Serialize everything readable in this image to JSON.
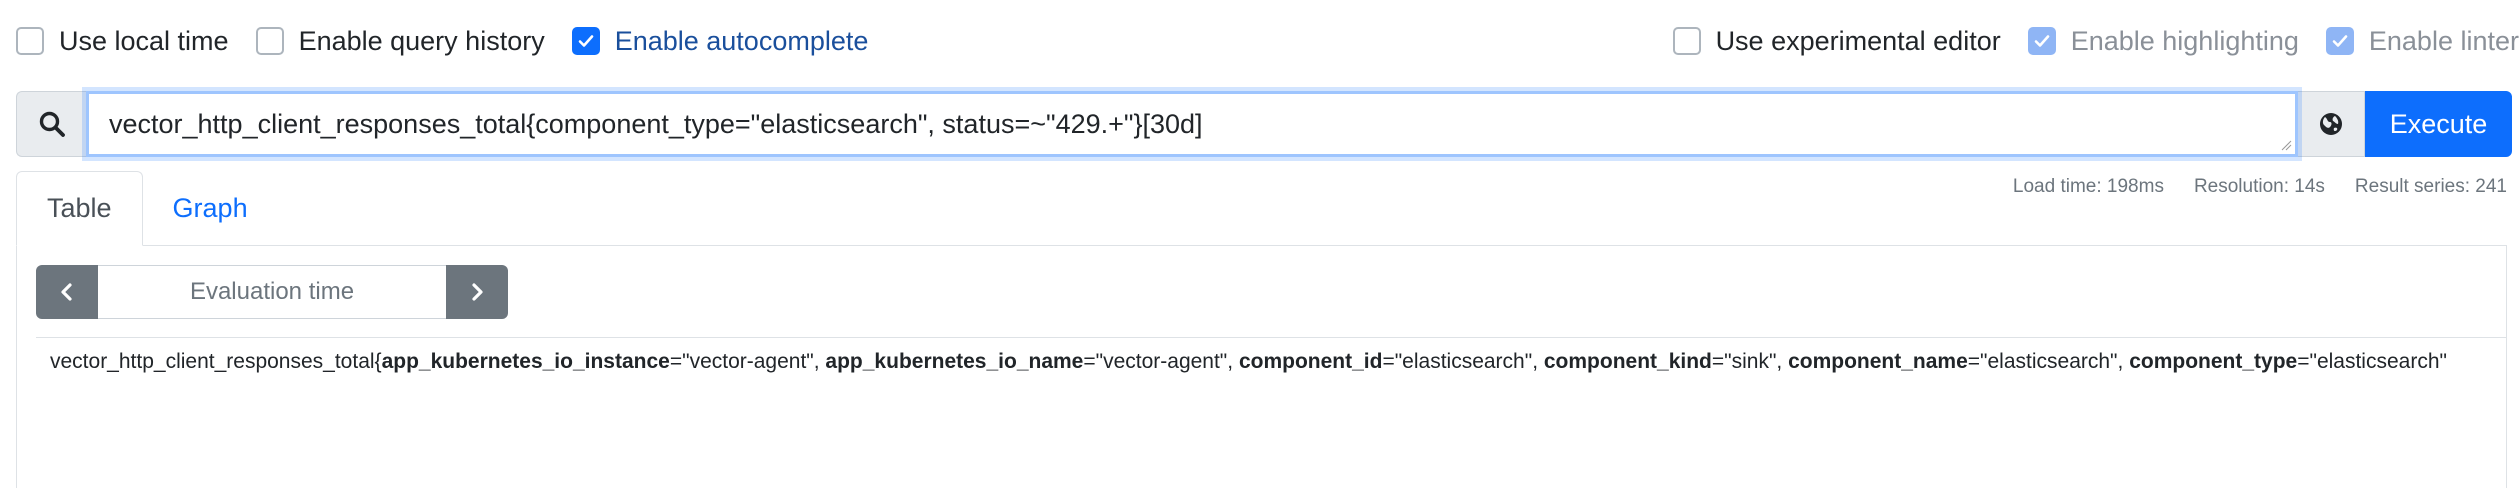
{
  "options": {
    "left": [
      {
        "label": "Use local time",
        "checked": false
      },
      {
        "label": "Enable query history",
        "checked": false
      },
      {
        "label": "Enable autocomplete",
        "checked": true
      }
    ],
    "right": [
      {
        "label": "Use experimental editor",
        "checked": false
      },
      {
        "label": "Enable highlighting",
        "checked": true,
        "disabled": true
      },
      {
        "label": "Enable linter",
        "checked": true,
        "disabled": true
      }
    ]
  },
  "query": {
    "icon": "search-icon",
    "expression": "vector_http_client_responses_total{component_type=\"elasticsearch\", status=~\"429.+\"}[30d]",
    "metrics_explorer_icon": "globe-icon",
    "execute_label": "Execute"
  },
  "stats": {
    "load_time": "Load time: 198ms",
    "resolution": "Resolution: 14s",
    "result_series": "Result series: 241"
  },
  "tabs": [
    {
      "label": "Table",
      "active": true
    },
    {
      "label": "Graph",
      "active": false
    }
  ],
  "evaluation": {
    "placeholder": "Evaluation time",
    "prev_icon": "chevron-left-icon",
    "next_icon": "chevron-right-icon"
  },
  "result": {
    "metric_name": "vector_http_client_responses_total",
    "labels": [
      {
        "key": "app_kubernetes_io_instance",
        "value": "\"vector-agent\""
      },
      {
        "key": "app_kubernetes_io_name",
        "value": "\"vector-agent\""
      },
      {
        "key": "component_id",
        "value": "\"elasticsearch\""
      },
      {
        "key": "component_kind",
        "value": "\"sink\""
      },
      {
        "key": "component_name",
        "value": "\"elasticsearch\""
      },
      {
        "key": "component_type",
        "value": "\"elasticsearch\""
      }
    ]
  },
  "colors": {
    "primary": "#0d6efd",
    "secondary": "#6c757d",
    "border": "#dee2e6"
  }
}
